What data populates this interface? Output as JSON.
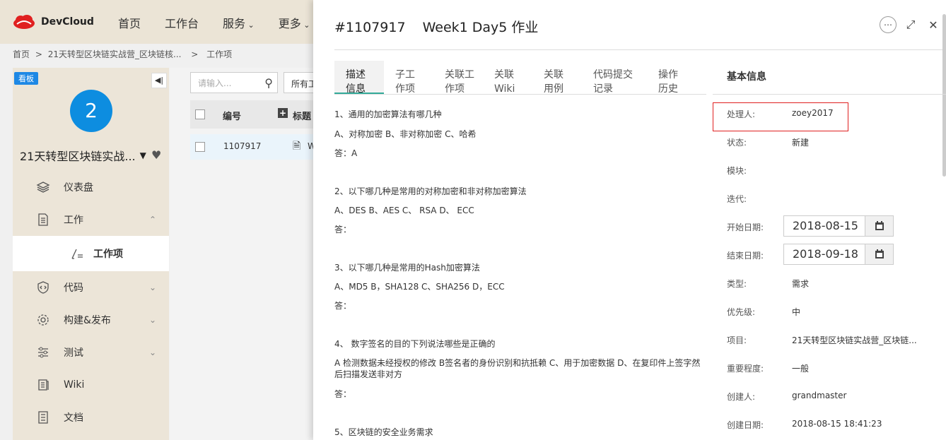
{
  "header": {
    "logo_text": "DevCloud",
    "nav": [
      {
        "label": "首页"
      },
      {
        "label": "工作台"
      },
      {
        "label": "服务"
      },
      {
        "label": "更多"
      }
    ],
    "breadcrumb": [
      "首页",
      ">",
      "21天转型区块链实战营_区块链核...",
      ">",
      "工作项"
    ]
  },
  "sidebar": {
    "board_badge": "看板",
    "avatar_number": "2",
    "project_name": "21天转型区块链实战...",
    "menu": [
      {
        "label": "仪表盘",
        "icon": "layers-icon"
      },
      {
        "label": "工作",
        "icon": "document-icon"
      },
      {
        "label": "工作项",
        "icon": "edit-list-icon",
        "active": true
      },
      {
        "label": "代码",
        "icon": "shield-code-icon"
      },
      {
        "label": "构建&发布",
        "icon": "gear-icon"
      },
      {
        "label": "测试",
        "icon": "sliders-icon"
      },
      {
        "label": "Wiki",
        "icon": "wiki-icon"
      },
      {
        "label": "文档",
        "icon": "file-list-icon"
      }
    ]
  },
  "list": {
    "search_placeholder": "请输入...",
    "filter_label": "所有工",
    "columns": [
      "编号",
      "标题"
    ],
    "rows": [
      {
        "id": "1107917",
        "title": "W"
      }
    ]
  },
  "panel": {
    "id": "#1107917",
    "title": "Week1 Day5 作业",
    "tabs": [
      {
        "label": "描述\n信息",
        "active": true
      },
      {
        "label": "子工\n作项"
      },
      {
        "label": "关联工\n作项"
      },
      {
        "label": "关联\nWiki"
      },
      {
        "label": "关联\n用例"
      },
      {
        "label": "代码提交\n记录"
      },
      {
        "label": "操作\n历史"
      }
    ],
    "description": [
      "1、通用的加密算法有哪几种",
      "A、对称加密  B、非对称加密 C、哈希",
      "答：A",
      "2、以下哪几种是常用的对称加密和非对称加密算法",
      "A、DES B、AES  C、 RSA  D、 ECC",
      "答：",
      "3、以下哪几种是常用的Hash加密算法",
      "A、MD5 B，SHA128 C、SHA256 D，ECC",
      "答：",
      "4、 数字签名的目的下列说法哪些是正确的",
      "A 检测数据未经授权的修改 B签名者的身份识别和抗抵赖 C、用于加密数据 D、在复印件上签字然后扫描发送非对方",
      "答：",
      "5、区块链的安全业务需求"
    ],
    "info": {
      "title": "基本信息",
      "assignee_label": "处理人:",
      "assignee": "zoey2017",
      "status_label": "状态:",
      "status": "新建",
      "module_label": "模块:",
      "iteration_label": "迭代:",
      "start_label": "开始日期:",
      "start_date": "2018-08-15",
      "end_label": "结束日期:",
      "end_date": "2018-09-18",
      "type_label": "类型:",
      "type": "需求",
      "priority_label": "优先级:",
      "priority": "中",
      "project_label": "项目:",
      "project": "21天转型区块链实战营_区块链...",
      "importance_label": "重要程度:",
      "importance": "一般",
      "creator_label": "创建人:",
      "creator": "grandmaster",
      "created_label": "创建日期:",
      "created": "2018-08-15 18:41:23"
    }
  }
}
